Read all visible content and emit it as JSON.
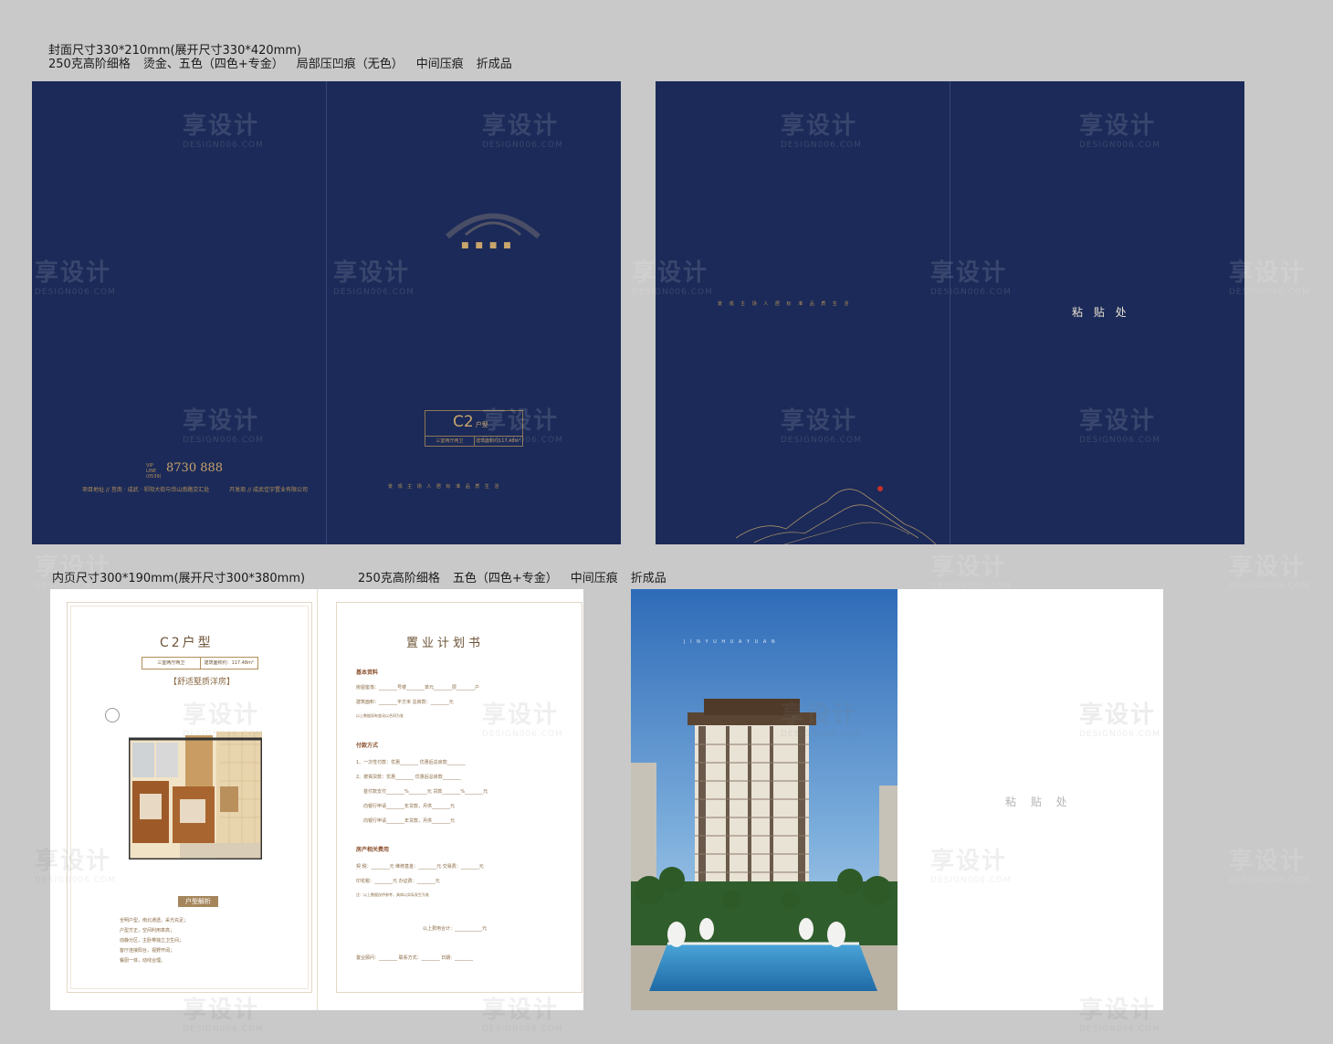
{
  "specs": {
    "cover_line1": "封面尺寸330*210mm(展开尺寸330*420mm)",
    "cover_line2": [
      "250克高阶细格",
      "烫金、五色（四色+专金）",
      "局部压凹痕（无色）",
      "中间压痕",
      "折成品"
    ],
    "inner_line1": "内页尺寸300*190mm(展开尺寸300*380mm)",
    "inner_line2": [
      "250克高阶细格",
      "五色（四色+专金）",
      "中间压痕",
      "折成品"
    ]
  },
  "cover_front": {
    "phone_prefix": "VIP LINE (0539)",
    "phone": "8730 888",
    "address": "项目地址 // 莒南 · 成武 · 祁阳大街与岱山南路交汇处",
    "developer": "开发商 // 成武佳宇置业有限公司",
    "unit_type": "C2",
    "unit_suffix": "户型",
    "unit_layout": "三室两厅两卫",
    "unit_area": "建筑面积约117.48m²",
    "tags": "景 观 主 场     人 居 标 准     品 质 生 活"
  },
  "cover_back": {
    "tags": "景 观 主 场     人 居 标 准     品 质 生 活",
    "paste_label": "粘 贴 处"
  },
  "inner_left": {
    "title": "C2户型",
    "layout": "三室两厅两卫",
    "area": "建筑面积约：117.48m²",
    "subtitle": "【舒适墅质洋房】",
    "analysis_label": "户型解析",
    "analysis_lines": [
      "全明户型，南北通透，采光充足；",
      "户型方正，空间利用率高；",
      "动静分区，主卧带独立卫生间；",
      "客厅连接阳台，视野开阔；",
      "餐厨一体，动线合理。"
    ],
    "plan_title": "置业计划书",
    "sections": {
      "basic": "基本资料",
      "payment": "付款方式",
      "fees": "房产相关费用"
    },
    "basic_lines": [
      "房屋座落：________号楼________单元________层________户",
      "建筑面积：________平方米      总房款：________元",
      "以上数据如有变动以合同为准"
    ],
    "payment_lines": [
      "1、一次性付款：优惠________     优惠后总房款________",
      "2、按揭贷款：优惠________     优惠后总房款________",
      "首付款支付________%________元     贷款________%________元",
      "向银行申请________年贷款，月供________元",
      "向银行申请________年贷款，月供________元"
    ],
    "fee_lines": [
      "契 税：________元     维修基金：________元     交易费：________元",
      "印花税：________元     办证费：________元",
      "注：以上数据仅供参考，具体以实际发生为准",
      "以上费用合计：____________元",
      "置业顾问：________     联系方式：________     日期：________"
    ]
  },
  "inner_right": {
    "photo_caption": "J I N Y U   H U A Y U A N",
    "paste_label": "粘 贴 处"
  },
  "watermark": {
    "text": "享设计",
    "url": "DESIGN006.COM"
  },
  "colors": {
    "navy": "#1b2a58",
    "gold": "#b38f5a",
    "brown": "#6d5437",
    "background": "#c9c9c9"
  }
}
